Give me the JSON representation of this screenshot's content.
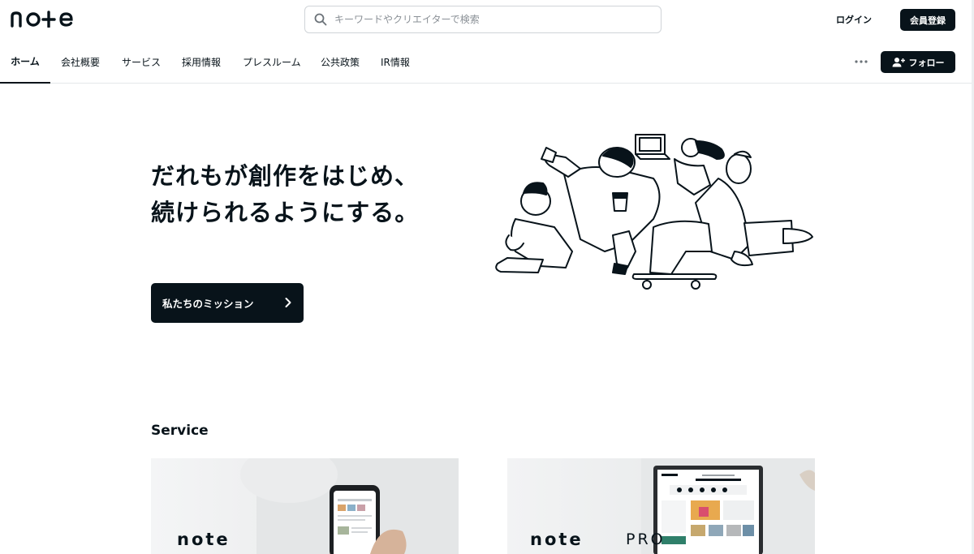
{
  "header": {
    "logo_text": "note",
    "search_placeholder": "キーワードやクリエイターで検索",
    "login_label": "ログイン",
    "signup_label": "会員登録"
  },
  "nav": {
    "tabs": [
      {
        "label": "ホーム",
        "active": true
      },
      {
        "label": "会社概要",
        "active": false
      },
      {
        "label": "サービス",
        "active": false
      },
      {
        "label": "採用情報",
        "active": false
      },
      {
        "label": "プレスルーム",
        "active": false
      },
      {
        "label": "公共政策",
        "active": false
      },
      {
        "label": "IR情報",
        "active": false
      }
    ],
    "follow_label": "フォロー"
  },
  "hero": {
    "title_line1": "だれもが創作をはじめ、",
    "title_line2": "続けられるようにする。",
    "mission_button": "私たちのミッション"
  },
  "service": {
    "heading": "Service",
    "cards": [
      {
        "brand": "note",
        "suffix": ""
      },
      {
        "brand": "note",
        "suffix": "PRO"
      }
    ]
  },
  "colors": {
    "primary": "#08131a",
    "border": "#d0d4d8",
    "background": "#ffffff"
  }
}
